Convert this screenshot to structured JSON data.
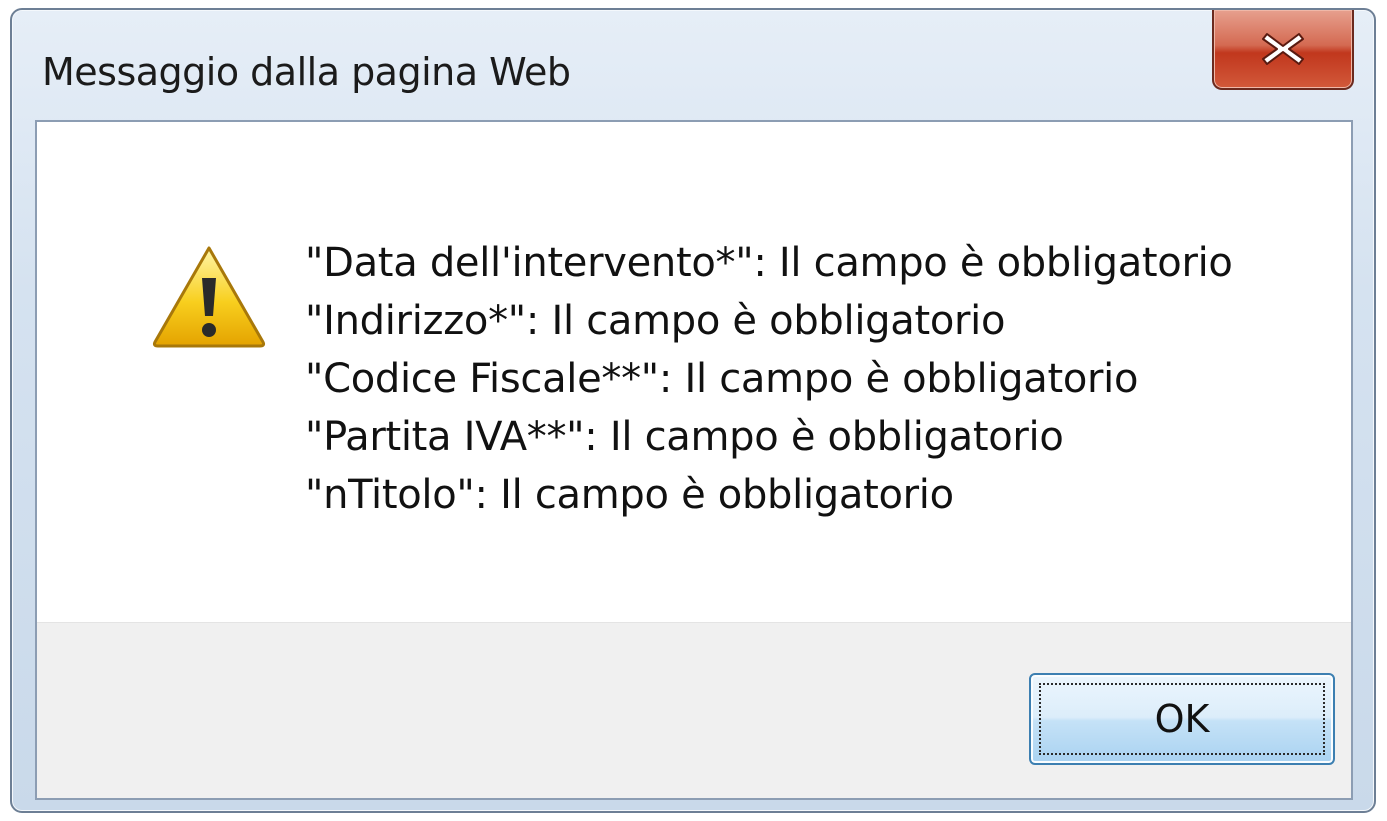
{
  "dialog": {
    "title": "Messaggio dalla pagina Web",
    "close_icon": "close-icon",
    "warning_icon": "warning-icon",
    "messages": [
      "\"Data dell'intervento*\": Il campo è obbligatorio",
      "\"Indirizzo*\": Il campo è obbligatorio",
      "\"Codice Fiscale**\": Il campo è obbligatorio",
      "\"Partita IVA**\": Il campo è obbligatorio",
      "\"nTitolo\": Il campo è obbligatorio"
    ],
    "ok_label": "OK"
  },
  "colors": {
    "close_button": "#c1371d",
    "ok_button_border": "#3c7fb1",
    "warning_fill": "#f5c400"
  }
}
